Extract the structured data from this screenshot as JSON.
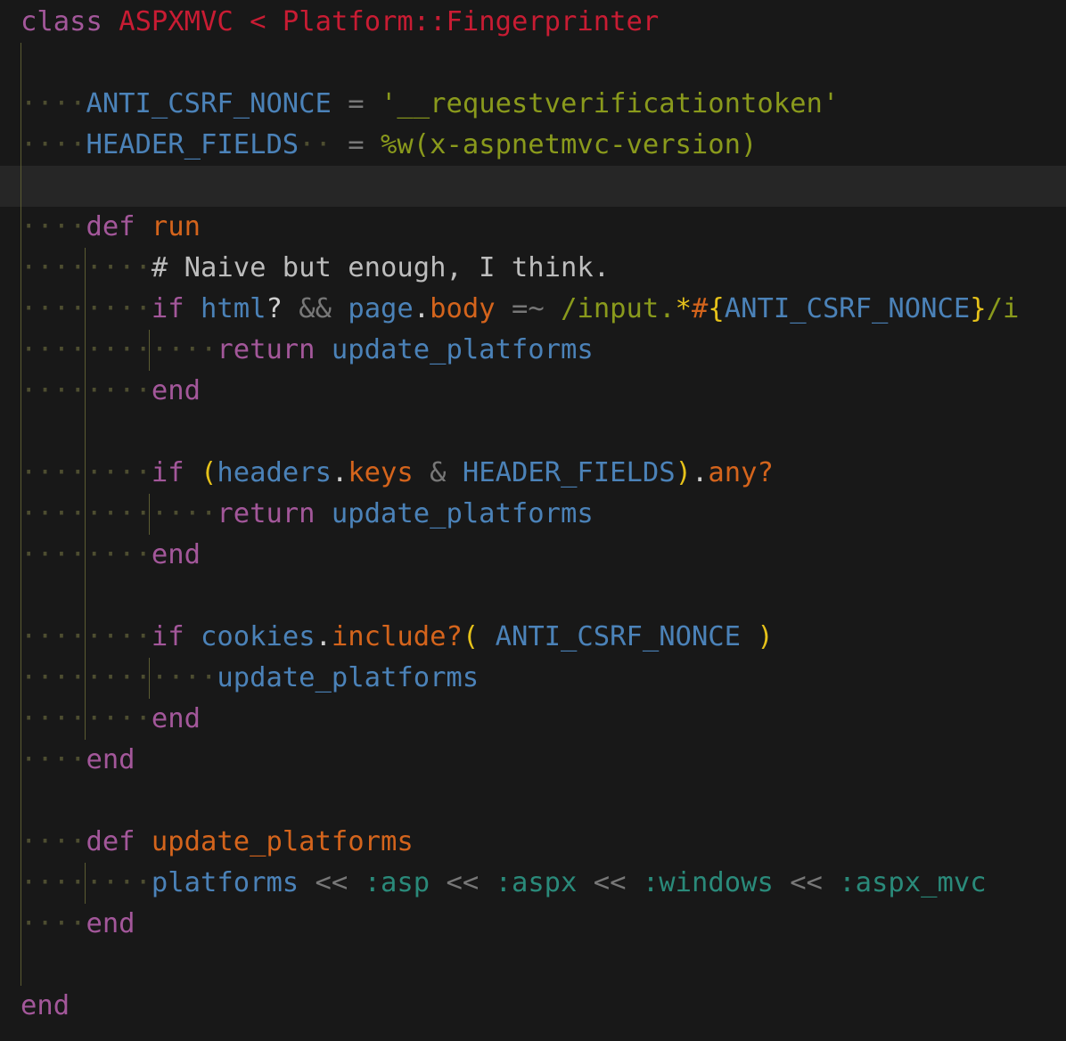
{
  "lines": [
    {
      "tokens": [
        [
          "class",
          "k-kw"
        ],
        [
          " ",
          "k-plain"
        ],
        [
          "ASPXMVC",
          "k-cls"
        ],
        [
          " ",
          "k-plain"
        ],
        [
          "<",
          "k-cls"
        ],
        [
          " ",
          "k-plain"
        ],
        [
          "Platform::Fingerprinter",
          "k-cls"
        ]
      ]
    },
    {
      "tokens": []
    },
    {
      "tokens": [
        [
          "····",
          "ws"
        ],
        [
          "ANTI_CSRF_NONCE",
          "k-const"
        ],
        [
          " ",
          "k-plain"
        ],
        [
          "=",
          "k-op"
        ],
        [
          " ",
          "k-plain"
        ],
        [
          "'__requestverificationtoken'",
          "k-str"
        ]
      ]
    },
    {
      "tokens": [
        [
          "····",
          "ws"
        ],
        [
          "HEADER_FIELDS",
          "k-const"
        ],
        [
          "··",
          "ws"
        ],
        [
          " ",
          "k-plain"
        ],
        [
          "=",
          "k-op"
        ],
        [
          " ",
          "k-plain"
        ],
        [
          "%w(x-aspnetmvc-version)",
          "k-str"
        ]
      ]
    },
    {
      "tokens": []
    },
    {
      "tokens": [
        [
          "····",
          "ws"
        ],
        [
          "def",
          "k-kw"
        ],
        [
          " ",
          "k-plain"
        ],
        [
          "run",
          "k-fn"
        ]
      ]
    },
    {
      "tokens": [
        [
          "········",
          "ws"
        ],
        [
          "# Naive but enough, I think.",
          "k-cmt"
        ]
      ]
    },
    {
      "tokens": [
        [
          "········",
          "ws"
        ],
        [
          "if",
          "k-kw"
        ],
        [
          " ",
          "k-plain"
        ],
        [
          "html",
          "k-id"
        ],
        [
          "?",
          "k-plain"
        ],
        [
          " ",
          "k-plain"
        ],
        [
          "&&",
          "k-op"
        ],
        [
          " ",
          "k-plain"
        ],
        [
          "page",
          "k-id"
        ],
        [
          ".",
          "k-plain"
        ],
        [
          "body",
          "k-fn"
        ],
        [
          " ",
          "k-plain"
        ],
        [
          "=~",
          "k-op"
        ],
        [
          " ",
          "k-plain"
        ],
        [
          "/input.",
          "k-str"
        ],
        [
          "*",
          "k-brk"
        ],
        [
          "#",
          "k-interp"
        ],
        [
          "{",
          "k-brk"
        ],
        [
          "ANTI_CSRF_NONCE",
          "k-const"
        ],
        [
          "}",
          "k-brk"
        ],
        [
          "/i",
          "k-str"
        ]
      ]
    },
    {
      "tokens": [
        [
          "············",
          "ws"
        ],
        [
          "return",
          "k-kw"
        ],
        [
          " ",
          "k-plain"
        ],
        [
          "update_platforms",
          "k-id"
        ]
      ]
    },
    {
      "tokens": [
        [
          "········",
          "ws"
        ],
        [
          "end",
          "k-kw"
        ]
      ]
    },
    {
      "tokens": []
    },
    {
      "tokens": [
        [
          "········",
          "ws"
        ],
        [
          "if",
          "k-kw"
        ],
        [
          " ",
          "k-plain"
        ],
        [
          "(",
          "k-brk"
        ],
        [
          "headers",
          "k-id"
        ],
        [
          ".",
          "k-plain"
        ],
        [
          "keys",
          "k-fn"
        ],
        [
          " ",
          "k-plain"
        ],
        [
          "&",
          "k-op"
        ],
        [
          " ",
          "k-plain"
        ],
        [
          "HEADER_FIELDS",
          "k-const"
        ],
        [
          ")",
          "k-brk"
        ],
        [
          ".",
          "k-plain"
        ],
        [
          "any?",
          "k-fn"
        ]
      ]
    },
    {
      "tokens": [
        [
          "············",
          "ws"
        ],
        [
          "return",
          "k-kw"
        ],
        [
          " ",
          "k-plain"
        ],
        [
          "update_platforms",
          "k-id"
        ]
      ]
    },
    {
      "tokens": [
        [
          "········",
          "ws"
        ],
        [
          "end",
          "k-kw"
        ]
      ]
    },
    {
      "tokens": []
    },
    {
      "tokens": [
        [
          "········",
          "ws"
        ],
        [
          "if",
          "k-kw"
        ],
        [
          " ",
          "k-plain"
        ],
        [
          "cookies",
          "k-id"
        ],
        [
          ".",
          "k-plain"
        ],
        [
          "include?",
          "k-fn"
        ],
        [
          "(",
          "k-brk"
        ],
        [
          " ",
          "k-plain"
        ],
        [
          "ANTI_CSRF_NONCE",
          "k-const"
        ],
        [
          " ",
          "k-plain"
        ],
        [
          ")",
          "k-brk"
        ]
      ]
    },
    {
      "tokens": [
        [
          "············",
          "ws"
        ],
        [
          "update_platforms",
          "k-id"
        ]
      ]
    },
    {
      "tokens": [
        [
          "········",
          "ws"
        ],
        [
          "end",
          "k-kw"
        ]
      ]
    },
    {
      "tokens": [
        [
          "····",
          "ws"
        ],
        [
          "end",
          "k-kw"
        ]
      ]
    },
    {
      "tokens": []
    },
    {
      "tokens": [
        [
          "····",
          "ws"
        ],
        [
          "def",
          "k-kw"
        ],
        [
          " ",
          "k-plain"
        ],
        [
          "update_platforms",
          "k-fn"
        ]
      ]
    },
    {
      "tokens": [
        [
          "········",
          "ws"
        ],
        [
          "platforms",
          "k-id"
        ],
        [
          " ",
          "k-plain"
        ],
        [
          "<<",
          "k-op"
        ],
        [
          " ",
          "k-plain"
        ],
        [
          ":asp",
          "k-sym"
        ],
        [
          " ",
          "k-plain"
        ],
        [
          "<<",
          "k-op"
        ],
        [
          " ",
          "k-plain"
        ],
        [
          ":aspx",
          "k-sym"
        ],
        [
          " ",
          "k-plain"
        ],
        [
          "<<",
          "k-op"
        ],
        [
          " ",
          "k-plain"
        ],
        [
          ":windows",
          "k-sym"
        ],
        [
          " ",
          "k-plain"
        ],
        [
          "<<",
          "k-op"
        ],
        [
          " ",
          "k-plain"
        ],
        [
          ":aspx_mvc",
          "k-sym"
        ]
      ]
    },
    {
      "tokens": [
        [
          "····",
          "ws"
        ],
        [
          "end",
          "k-kw"
        ]
      ]
    },
    {
      "tokens": []
    },
    {
      "tokens": [
        [
          "end",
          "k-kw"
        ]
      ]
    }
  ],
  "current_line": 4
}
